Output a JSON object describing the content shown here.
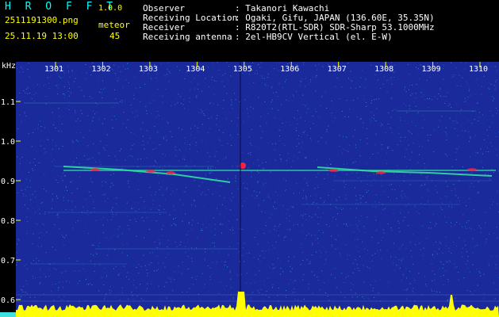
{
  "header": {
    "app_name": "H R O F F T",
    "version": "1.0.0",
    "filename": "2511191300.png",
    "datetime": "25.11.19 13:00",
    "meteor_label": "meteor",
    "meteor_count": "45",
    "fields": [
      {
        "label": "Observer",
        "value": ": Takanori Kawachi"
      },
      {
        "label": "Receiving Location",
        "value": ": Ogaki, Gifu, JAPAN (136.60E, 35.35N)"
      },
      {
        "label": "Receiver",
        "value": ": R820T2(RTL-SDR) SDR-Sharp 53.1000MHz"
      },
      {
        "label": "Receiving antenna",
        "value": ": 2el-HB9CV Vertical (el. E-W)"
      }
    ]
  },
  "plot": {
    "y_unit": "kHz",
    "time_ticks": [
      "1301",
      "1302",
      "1303",
      "1304",
      "1305",
      "1306",
      "1307",
      "1308",
      "1309",
      "1310"
    ],
    "freq_ticks": [
      "1.1",
      "1.0",
      "0.9",
      "0.8",
      "0.7",
      "0.6"
    ],
    "colors": {
      "background": "#1a2a9a",
      "tick": "#ffff00",
      "signal": "#30e0a0",
      "peak": "#ff2040",
      "activity": "#ffff00"
    }
  }
}
